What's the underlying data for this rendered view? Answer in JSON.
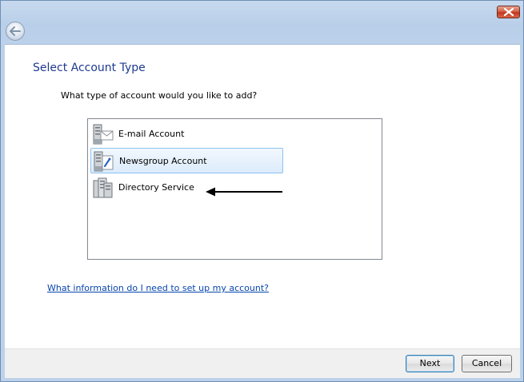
{
  "wizard": {
    "title": "Select Account Type",
    "prompt": "What type of account would you like to add?",
    "help_link": "What information do I need to set up my account?"
  },
  "accounts": [
    {
      "label": "E-mail Account",
      "icon": "email-server-icon",
      "selected": false
    },
    {
      "label": "Newsgroup Account",
      "icon": "newsgroup-server-icon",
      "selected": true
    },
    {
      "label": "Directory Service",
      "icon": "directory-server-icon",
      "selected": false
    }
  ],
  "buttons": {
    "next_label": "Next",
    "cancel_label": "Cancel"
  },
  "icons": {
    "close": "close-icon",
    "back": "back-arrow-icon",
    "annotation_arrow": "arrow-left-icon"
  },
  "colors": {
    "title": "#1e3a8f",
    "link": "#0645ad",
    "selection": "#dcebfc",
    "close": "#c2361a"
  }
}
